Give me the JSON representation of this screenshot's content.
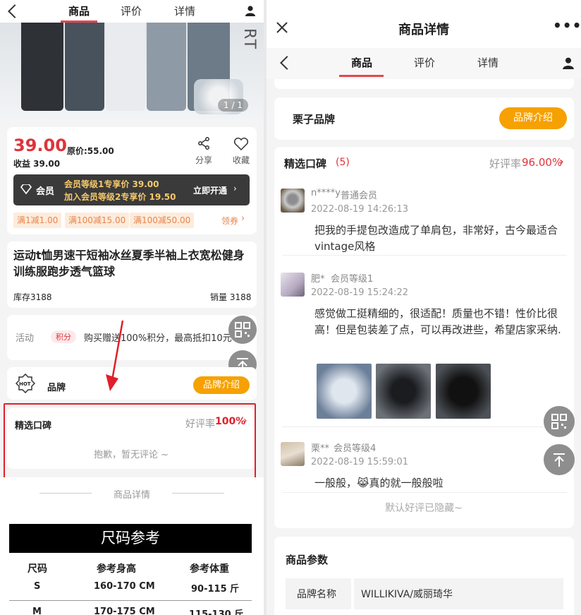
{
  "left": {
    "nav": {
      "tabs": [
        "商品",
        "评价",
        "详情"
      ]
    },
    "banner": {
      "text": "RT",
      "counter": "1 / 1"
    },
    "price": {
      "value": "39.00",
      "original": "原价:55.00",
      "earnings": "收益 39.00",
      "share": "分享",
      "fav": "收藏"
    },
    "vip": {
      "label": "会员",
      "line1": "会员等级1专享价 39.00",
      "line2": "加入会员等级2专享价 19.50",
      "cta": "立即开通"
    },
    "coupons": [
      "满1减1.00",
      "满100减15.00",
      "满100减50.00"
    ],
    "coupon_more": "领券",
    "product": {
      "title": "运动t恤男速干短袖冰丝夏季半袖上衣宽松健身训练服跑步透气篮球",
      "stock": "库存3188",
      "sales": "销量 3188"
    },
    "activity": {
      "label": "活动",
      "tag": "积分",
      "text": "购买赠送100%积分，最高抵扣10元"
    },
    "brand": {
      "hot": "HOT",
      "label": "品牌",
      "btn": "品牌介绍"
    },
    "reviews": {
      "title": "精选口碑",
      "rate_label": "好评率",
      "rate": "100%",
      "empty": "抱歉，暂无评论 ~"
    },
    "detail_title": "商品详情",
    "size_table": {
      "title": "尺码参考",
      "headers": [
        "尺码",
        "参考身高",
        "参考体重"
      ],
      "rows": [
        [
          "S",
          "160-170 CM",
          "90-115 斤"
        ],
        [
          "M",
          "170-175 CM",
          "115-130 斤"
        ]
      ]
    }
  },
  "right": {
    "title": "商品详情",
    "nav": {
      "tabs": [
        "商品",
        "评价",
        "详情"
      ]
    },
    "brand": {
      "name": "栗子品牌",
      "btn": "品牌介绍"
    },
    "reviews": {
      "title": "精选口碑",
      "count": "(5)",
      "rate_label": "好评率",
      "rate": "96.00%",
      "items": [
        {
          "user": "n****y",
          "level": "普通会员",
          "date": "2022-08-19 14:26:13",
          "text": "把我的手提包改造成了单肩包，非常好，古今最适合vintage风格"
        },
        {
          "user": "肥*",
          "level": "会员等级1",
          "date": "2022-08-19 15:24:22",
          "text": "感觉做工挺精细的，很适配！质量也不错！性价比很高！但是包装差了点，可以再改进些，希望店家采纳."
        },
        {
          "user": "栗**",
          "level": "会员等级4",
          "date": "2022-08-19 15:59:01",
          "text": "一般般，😹真的就一般般啦"
        }
      ],
      "hidden": "默认好评已隐藏~"
    },
    "params": {
      "title": "商品参数",
      "rows": [
        {
          "key": "品牌名称",
          "value": "WILLIKIVA/威丽琦华"
        }
      ]
    }
  },
  "colors": {
    "accent": "#e0333a",
    "orange": "#f6a100",
    "gold": "#f5c96a"
  }
}
